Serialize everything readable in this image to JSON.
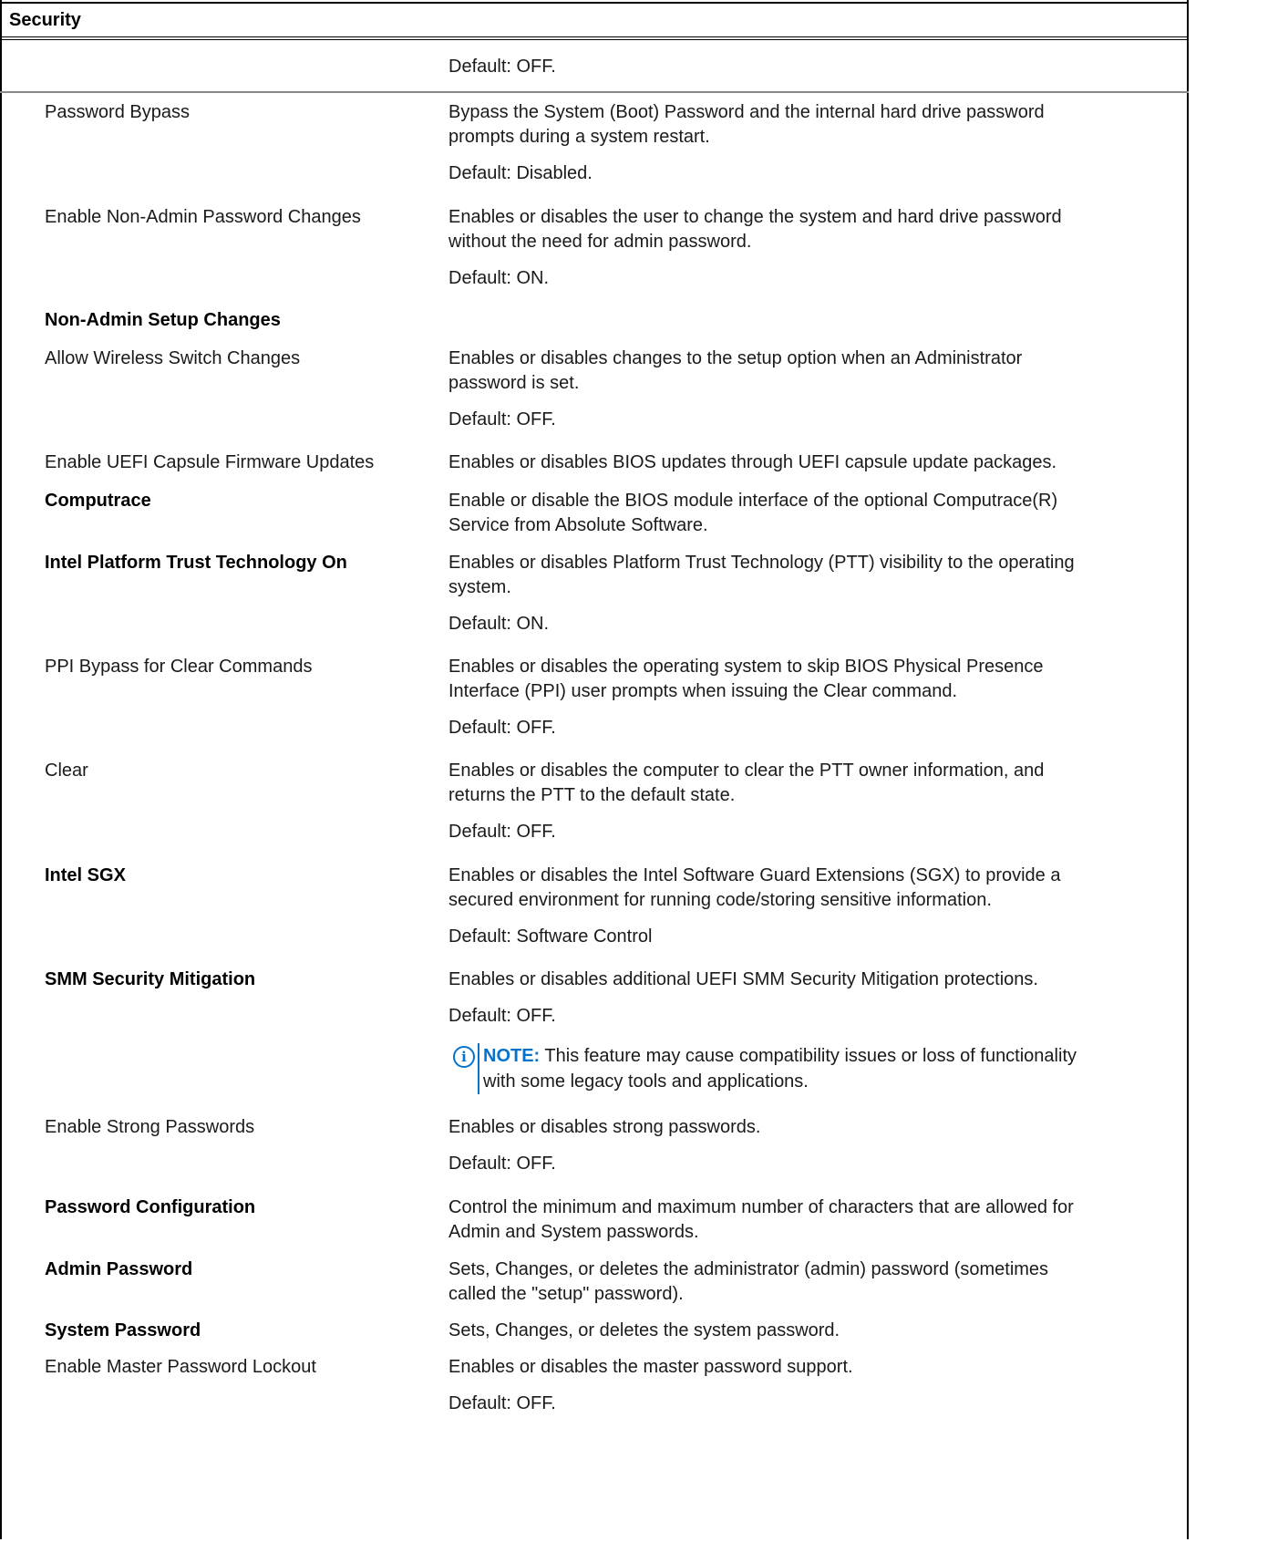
{
  "section": {
    "title": "Security"
  },
  "rows": [
    {
      "label": "",
      "label_bold": false,
      "description": [],
      "default": "Default: OFF."
    },
    {
      "label": "Password Bypass",
      "label_bold": false,
      "description": [
        "Bypass the System (Boot) Password and the internal hard drive password",
        "prompts during a system restart."
      ],
      "default": "Default: Disabled."
    },
    {
      "label": "Enable Non-Admin Password Changes",
      "label_bold": false,
      "description": [
        "Enables or disables the user to change the system and hard drive password",
        "without the need for admin password."
      ],
      "default": "Default: ON."
    },
    {
      "label": "Non-Admin Setup Changes",
      "label_bold": true,
      "description": [],
      "default": ""
    },
    {
      "label": "Allow Wireless Switch Changes",
      "label_bold": false,
      "description": [
        "Enables or disables changes to the setup option when an Administrator",
        "password is set."
      ],
      "default": "Default: OFF."
    },
    {
      "label": "Enable UEFI Capsule Firmware Updates",
      "label_bold": false,
      "description": [
        "Enables or disables BIOS updates through UEFI capsule update packages."
      ],
      "default": ""
    },
    {
      "label": "Computrace",
      "label_bold": true,
      "description": [
        "Enable or disable the BIOS module interface of the optional Computrace(R)",
        "Service from Absolute Software."
      ],
      "default": ""
    },
    {
      "label": "Intel Platform Trust Technology On",
      "label_bold": true,
      "description": [
        "Enables or disables Platform Trust Technology (PTT) visibility to the operating",
        "system."
      ],
      "default": "Default: ON."
    },
    {
      "label": "PPI Bypass for Clear Commands",
      "label_bold": false,
      "description": [
        "Enables or disables the operating system to skip BIOS Physical Presence",
        "Interface (PPI) user prompts when issuing the Clear command."
      ],
      "default": "Default: OFF."
    },
    {
      "label": "Clear",
      "label_bold": false,
      "description": [
        "Enables or disables the computer to clear the PTT owner information, and",
        "returns the PTT to the default state."
      ],
      "default": "Default: OFF."
    },
    {
      "label": "Intel SGX",
      "label_bold": true,
      "description": [
        "Enables or disables the Intel Software Guard Extensions (SGX) to provide a",
        "secured environment for running code/storing sensitive information."
      ],
      "default": "Default: Software Control"
    },
    {
      "label": "SMM Security Mitigation",
      "label_bold": true,
      "description": [
        "Enables or disables additional UEFI SMM Security Mitigation protections."
      ],
      "default": "Default: OFF."
    },
    {
      "label": "Enable Strong Passwords",
      "label_bold": false,
      "description": [
        "Enables or disables strong passwords."
      ],
      "default": "Default: OFF."
    },
    {
      "label": "Password Configuration",
      "label_bold": true,
      "description": [
        "Control the minimum and maximum number of characters that are allowed for",
        "Admin and System passwords."
      ],
      "default": ""
    },
    {
      "label": "Admin Password",
      "label_bold": true,
      "description": [
        "Sets, Changes, or deletes the administrator (admin) password (sometimes",
        "called the \"setup\" password)."
      ],
      "default": ""
    },
    {
      "label": "System Password",
      "label_bold": true,
      "description": [
        "Sets, Changes, or deletes the system password."
      ],
      "default": ""
    },
    {
      "label": "Enable Master Password Lockout",
      "label_bold": false,
      "description": [
        "Enables or disables the master password support."
      ],
      "default": "Default: OFF."
    }
  ],
  "note": {
    "icon": "info-icon",
    "label": "NOTE:",
    "line1": " This feature may cause compatibility issues or loss of functionality",
    "line2": "with some legacy tools and applications."
  },
  "colors": {
    "accent": "#0672cb",
    "border": "#000000",
    "divider": "#888888"
  }
}
